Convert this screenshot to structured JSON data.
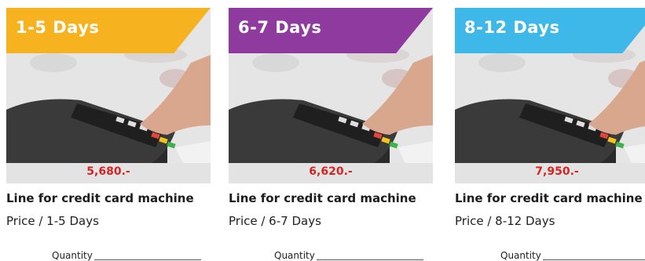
{
  "cards": [
    {
      "ribbon": "1-5 Days",
      "ribbon_color": "#F7B21F",
      "price": "5,680.-",
      "title": "Line for credit card machine",
      "subtitle": "Price / 1-5 Days",
      "quantity_label": "Quantity"
    },
    {
      "ribbon": "6-7 Days",
      "ribbon_color": "#8E3A9E",
      "price": "6,620.-",
      "title": "Line for credit card machine",
      "subtitle": "Price / 6-7 Days",
      "quantity_label": "Quantity"
    },
    {
      "ribbon": "8-12 Days",
      "ribbon_color": "#3DB8E8",
      "price": "7,950.-",
      "title": "Line for credit card machine",
      "subtitle": "Price / 8-12 Days",
      "quantity_label": "Quantity"
    }
  ],
  "colors": {
    "price_text": "#D42525",
    "price_bar": "#E3E3E3"
  },
  "icons": [
    "credit-card-terminal-photo"
  ]
}
